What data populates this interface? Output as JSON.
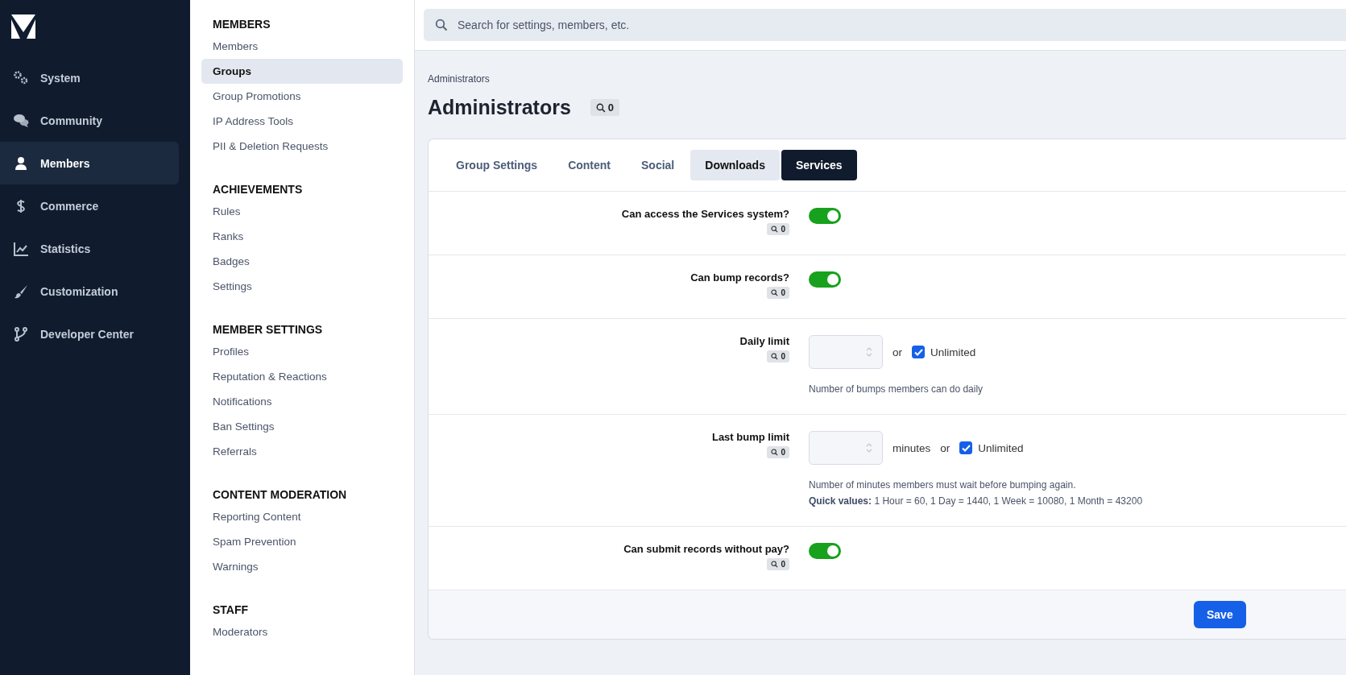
{
  "sidebar": {
    "items": [
      {
        "label": "System",
        "selected": false
      },
      {
        "label": "Community",
        "selected": false
      },
      {
        "label": "Members",
        "selected": true
      },
      {
        "label": "Commerce",
        "selected": false
      },
      {
        "label": "Statistics",
        "selected": false
      },
      {
        "label": "Customization",
        "selected": false
      },
      {
        "label": "Developer Center",
        "selected": false
      }
    ]
  },
  "subnav": {
    "sections": [
      {
        "heading": "MEMBERS",
        "items": [
          {
            "label": "Members",
            "selected": false
          },
          {
            "label": "Groups",
            "selected": true
          },
          {
            "label": "Group Promotions",
            "selected": false
          },
          {
            "label": "IP Address Tools",
            "selected": false
          },
          {
            "label": "PII & Deletion Requests",
            "selected": false
          }
        ]
      },
      {
        "heading": "ACHIEVEMENTS",
        "items": [
          {
            "label": "Rules",
            "selected": false
          },
          {
            "label": "Ranks",
            "selected": false
          },
          {
            "label": "Badges",
            "selected": false
          },
          {
            "label": "Settings",
            "selected": false
          }
        ]
      },
      {
        "heading": "MEMBER SETTINGS",
        "items": [
          {
            "label": "Profiles",
            "selected": false
          },
          {
            "label": "Reputation & Reactions",
            "selected": false
          },
          {
            "label": "Notifications",
            "selected": false
          },
          {
            "label": "Ban Settings",
            "selected": false
          },
          {
            "label": "Referrals",
            "selected": false
          }
        ]
      },
      {
        "heading": "CONTENT MODERATION",
        "items": [
          {
            "label": "Reporting Content",
            "selected": false
          },
          {
            "label": "Spam Prevention",
            "selected": false
          },
          {
            "label": "Warnings",
            "selected": false
          }
        ]
      },
      {
        "heading": "STAFF",
        "items": [
          {
            "label": "Moderators",
            "selected": false
          }
        ]
      }
    ]
  },
  "search": {
    "placeholder": "Search for settings, members, etc."
  },
  "breadcrumb": "Administrators",
  "title": "Administrators",
  "title_badge": "0",
  "tabs": [
    {
      "label": "Group Settings",
      "selected": false,
      "hovered": false
    },
    {
      "label": "Content",
      "selected": false,
      "hovered": false
    },
    {
      "label": "Social",
      "selected": false,
      "hovered": false
    },
    {
      "label": "Downloads",
      "selected": false,
      "hovered": true
    },
    {
      "label": "Services",
      "selected": true,
      "hovered": false
    }
  ],
  "rows": [
    {
      "kind": "toggle",
      "label": "Can access the Services system?",
      "badge": "0",
      "on": true
    },
    {
      "kind": "toggle",
      "label": "Can bump records?",
      "badge": "0",
      "on": true
    },
    {
      "kind": "number",
      "label": "Daily limit",
      "badge": "0",
      "or": "or",
      "unlimited_label": "Unlimited",
      "unlimited": true,
      "hints": [
        "Number of bumps members can do daily"
      ]
    },
    {
      "kind": "number",
      "label": "Last bump limit",
      "badge": "0",
      "unit": "minutes",
      "or": "or",
      "unlimited_label": "Unlimited",
      "unlimited": true,
      "hints": [
        "Number of minutes members must wait before bumping again.",
        "**Quick values:** 1 Hour = 60, 1 Day = 1440, 1 Week = 10080, 1 Month = 43200"
      ]
    },
    {
      "kind": "toggle",
      "label": "Can submit records without pay?",
      "badge": "0",
      "on": true
    }
  ],
  "save_button": "Save"
}
